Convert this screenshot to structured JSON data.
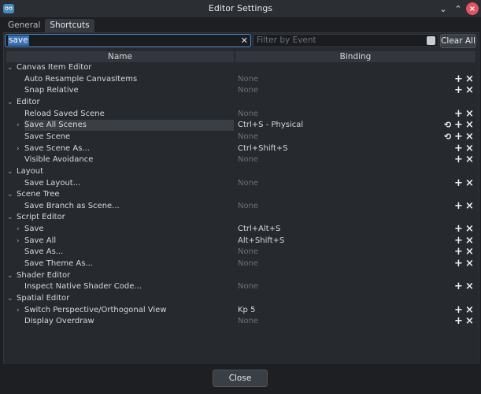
{
  "window": {
    "title": "Editor Settings"
  },
  "tabs": [
    {
      "label": "General"
    },
    {
      "label": "Shortcuts"
    }
  ],
  "search": {
    "value": "save",
    "event_placeholder": "Filter by Event",
    "clear_all_label": "Clear All"
  },
  "columns": {
    "name": "Name",
    "binding": "Binding"
  },
  "rows": [
    {
      "label": "Canvas Item Editor",
      "type": "category"
    },
    {
      "label": "Auto Resample CanvasItems",
      "binding": "None",
      "type": "item"
    },
    {
      "label": "Snap Relative",
      "binding": "None",
      "type": "item"
    },
    {
      "label": "Editor",
      "type": "category"
    },
    {
      "label": "Reload Saved Scene",
      "binding": "None",
      "type": "item"
    },
    {
      "label": "Save All Scenes",
      "binding": "Ctrl+S - Physical",
      "type": "item",
      "expandable": true,
      "selected": true,
      "revert": true
    },
    {
      "label": "Save Scene",
      "binding": "None",
      "type": "item",
      "revert": true
    },
    {
      "label": "Save Scene As...",
      "binding": "Ctrl+Shift+S",
      "type": "item",
      "expandable": true
    },
    {
      "label": "Visible Avoidance",
      "binding": "None",
      "type": "item"
    },
    {
      "label": "Layout",
      "type": "category"
    },
    {
      "label": "Save Layout...",
      "binding": "None",
      "type": "item"
    },
    {
      "label": "Scene Tree",
      "type": "category"
    },
    {
      "label": "Save Branch as Scene...",
      "binding": "None",
      "type": "item"
    },
    {
      "label": "Script Editor",
      "type": "category"
    },
    {
      "label": "Save",
      "binding": "Ctrl+Alt+S",
      "type": "item",
      "expandable": true
    },
    {
      "label": "Save All",
      "binding": "Alt+Shift+S",
      "type": "item",
      "expandable": true
    },
    {
      "label": "Save As...",
      "binding": "None",
      "type": "item"
    },
    {
      "label": "Save Theme As...",
      "binding": "None",
      "type": "item"
    },
    {
      "label": "Shader Editor",
      "type": "category"
    },
    {
      "label": "Inspect Native Shader Code...",
      "binding": "None",
      "type": "item"
    },
    {
      "label": "Spatial Editor",
      "type": "category"
    },
    {
      "label": "Switch Perspective/Orthogonal View",
      "binding": "Kp 5",
      "type": "item",
      "expandable": true
    },
    {
      "label": "Display Overdraw",
      "binding": "None",
      "type": "item"
    }
  ],
  "icons": {
    "add": "+",
    "erase": "×",
    "revert": "⟲",
    "collapse": "⌄",
    "expand": "›"
  },
  "footer": {
    "close_label": "Close"
  }
}
